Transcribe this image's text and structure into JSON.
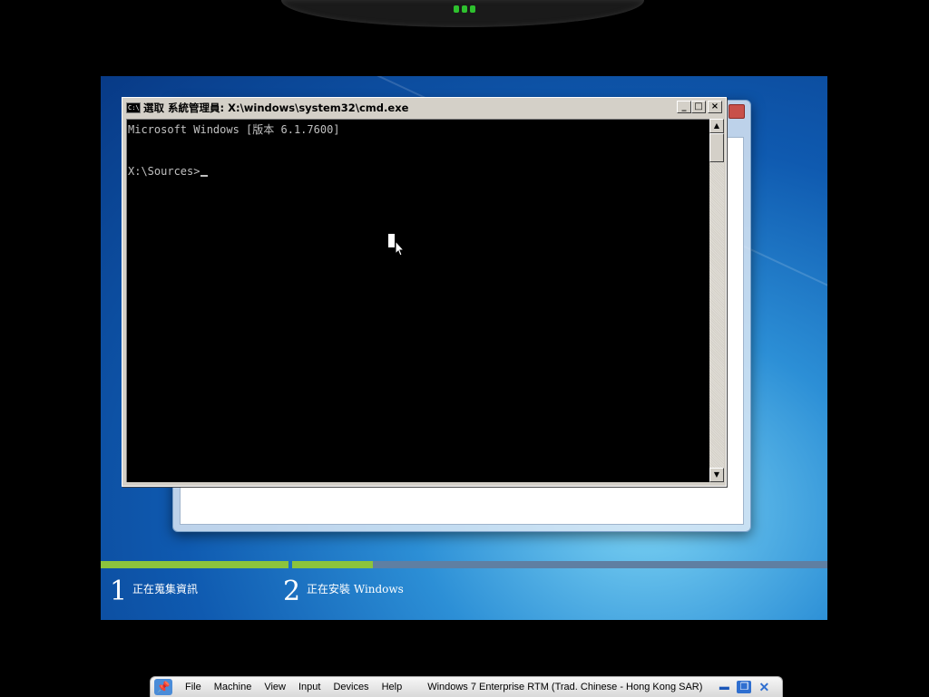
{
  "cmd_window": {
    "title": "選取 系統管理員: X:\\windows\\system32\\cmd.exe",
    "icon_label": "C:\\",
    "buttons": {
      "minimize": "_",
      "maximize": "□",
      "close": "×"
    },
    "console_lines": [
      "Microsoft Windows [版本 6.1.7600]",
      "",
      "X:\\Sources>"
    ]
  },
  "setup_progress": {
    "steps": [
      {
        "number": "1",
        "label": "正在蒐集資訊"
      },
      {
        "number": "2",
        "label": "正在安裝 Windows"
      }
    ],
    "step1_progress": 1.0,
    "step2_progress": 0.15,
    "colors": {
      "fill": "#8cc43c",
      "track": "#5f7fa2"
    }
  },
  "vbox_toolbar": {
    "pin_icon": "pin-icon",
    "menus": [
      "File",
      "Machine",
      "View",
      "Input",
      "Devices",
      "Help"
    ],
    "vm_title": "Windows 7 Enterprise RTM (Trad. Chinese - Hong Kong SAR)"
  }
}
